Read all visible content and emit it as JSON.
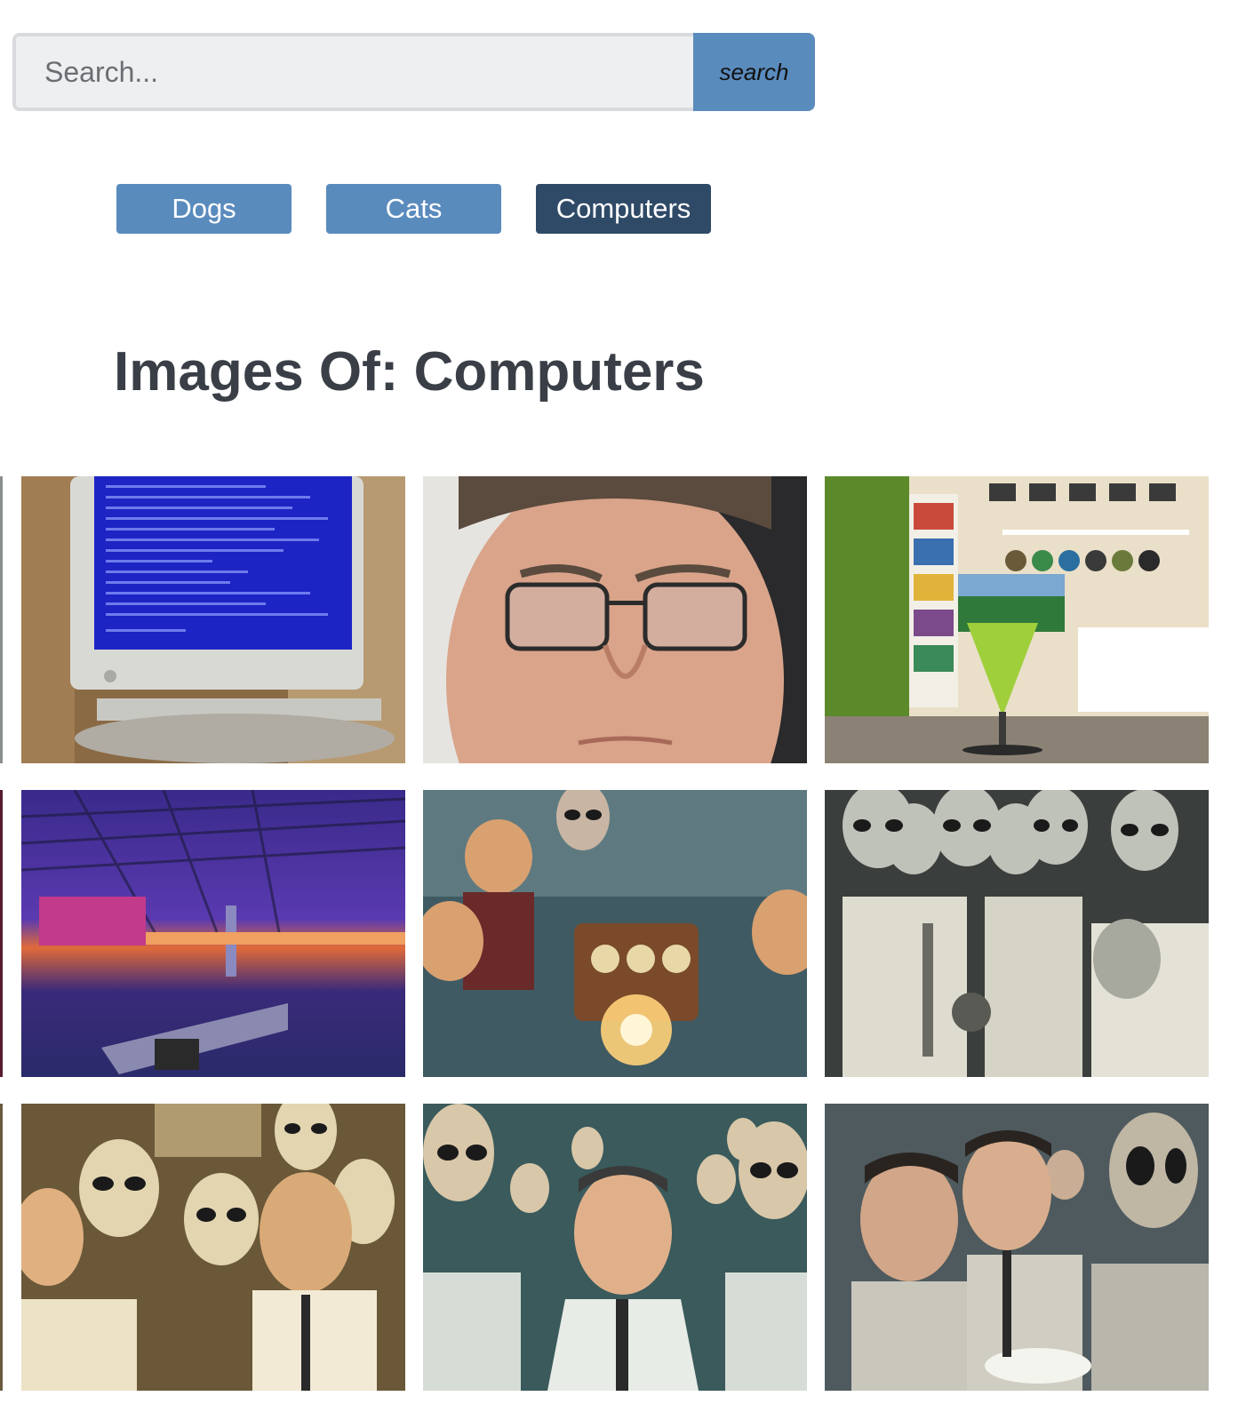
{
  "search": {
    "placeholder": "Search...",
    "button_label": "search"
  },
  "categories": [
    {
      "label": "Dogs",
      "active": false
    },
    {
      "label": "Cats",
      "active": false
    },
    {
      "label": "Computers",
      "active": true
    }
  ],
  "heading": {
    "prefix": "Images Of:",
    "topic": "Computers"
  },
  "colors": {
    "button": "#5a8bbd",
    "button_active": "#2f4a67",
    "heading_text": "#3a3f47",
    "input_bg": "#eeeff1"
  },
  "images": [
    {
      "subject": "old-crt-monitor-blue-screen"
    },
    {
      "subject": "man-with-glasses-selfie"
    },
    {
      "subject": "home-office-green-chair"
    },
    {
      "subject": "neon-lit-lan-arena"
    },
    {
      "subject": "alien-and-scientists-machine"
    },
    {
      "subject": "aliens-laughing-scientist-bw"
    },
    {
      "subject": "aliens-laughing-scientists-sepia"
    },
    {
      "subject": "alien-laughing-scientist-teal"
    },
    {
      "subject": "scientists-and-alien-lab"
    }
  ]
}
